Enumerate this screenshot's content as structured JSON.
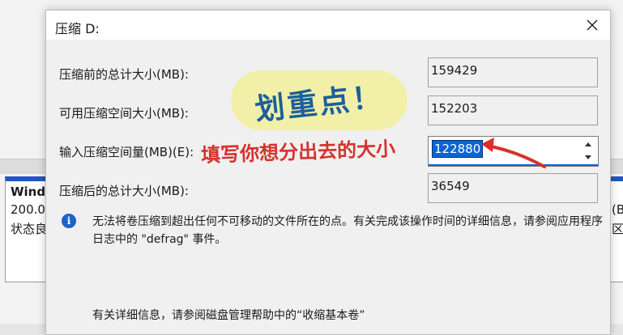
{
  "background": {
    "volume_lines": [
      "Wind",
      "200.0(",
      "状态良"
    ],
    "right_lines": [
      "(B",
      "区)"
    ]
  },
  "dialog": {
    "title": "压缩 D:",
    "close_icon": "close-icon",
    "fields": [
      {
        "label": "压缩前的总计大小(MB):",
        "value": "159429"
      },
      {
        "label": "可用压缩空间大小(MB):",
        "value": "152203"
      },
      {
        "label": "输入压缩空间量(MB)(E):",
        "value": "122880"
      },
      {
        "label": "压缩后的总计大小(MB):",
        "value": "36549"
      }
    ],
    "info_icon": "info-icon",
    "info_text": "无法将卷压缩到超出任何不可移动的文件所在的点。有关完成该操作时间的详细信息，请参阅应用程序日志中的 \"defrag\" 事件。",
    "help_text": "有关详细信息，请参阅磁盘管理帮助中的“收缩基本卷”"
  },
  "annotations": {
    "bubble": "划重点！",
    "red_note": "填写你想分出去的大小"
  },
  "colors": {
    "accent": "#0a64d8",
    "annotation_red": "#d7312e",
    "bubble_bg": "#f2f0a8",
    "bubble_text": "#1d5f9c",
    "volume_bar": "#1f57c3"
  }
}
